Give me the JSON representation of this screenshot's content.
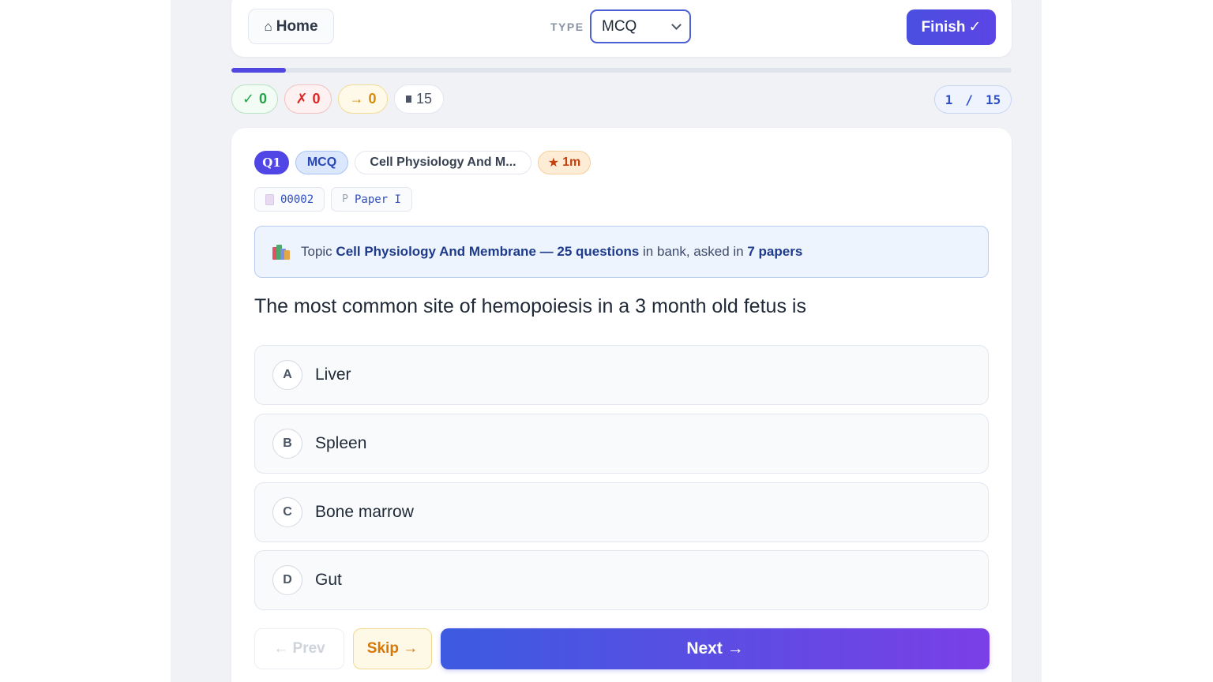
{
  "header": {
    "home_label": "Home",
    "home_icon": "home-icon",
    "type_label": "TYPE",
    "type_value": "MCQ",
    "finish_label": "Finish",
    "finish_check": "✓"
  },
  "progress": {
    "current": 1,
    "total": 15,
    "percent": 7
  },
  "stats": {
    "correct_icon": "✓",
    "correct": "0",
    "wrong_icon": "✗",
    "wrong": "0",
    "skipped_icon": "→",
    "skipped": "0",
    "total": "15"
  },
  "counter": {
    "current": "1",
    "sep": "/",
    "total": "15"
  },
  "question": {
    "badge": "Q1",
    "type": "MCQ",
    "topic_short": "Cell Physiology And M...",
    "time": "1m",
    "time_icon": "★",
    "code": "00002",
    "paper_prefix": "P",
    "paper": "Paper I",
    "topic_info": {
      "prefix": "Topic",
      "topic": "Cell Physiology And Membrane",
      "dash": "—",
      "count": "25 questions",
      "mid": "in bank, asked in",
      "papers": "7 papers"
    },
    "text": "The most common site of hemopoiesis in a 3 month old fetus is",
    "options": [
      {
        "letter": "A",
        "text": "Liver"
      },
      {
        "letter": "B",
        "text": "Spleen"
      },
      {
        "letter": "C",
        "text": "Bone marrow"
      },
      {
        "letter": "D",
        "text": "Gut"
      }
    ]
  },
  "nav": {
    "prev_label": "← Prev",
    "skip_label": "Skip →",
    "next_label": "Next →"
  },
  "colors": {
    "accent": "#4f46e5",
    "correct": "#22a34a",
    "wrong": "#dc2626",
    "skip": "#d97706"
  }
}
